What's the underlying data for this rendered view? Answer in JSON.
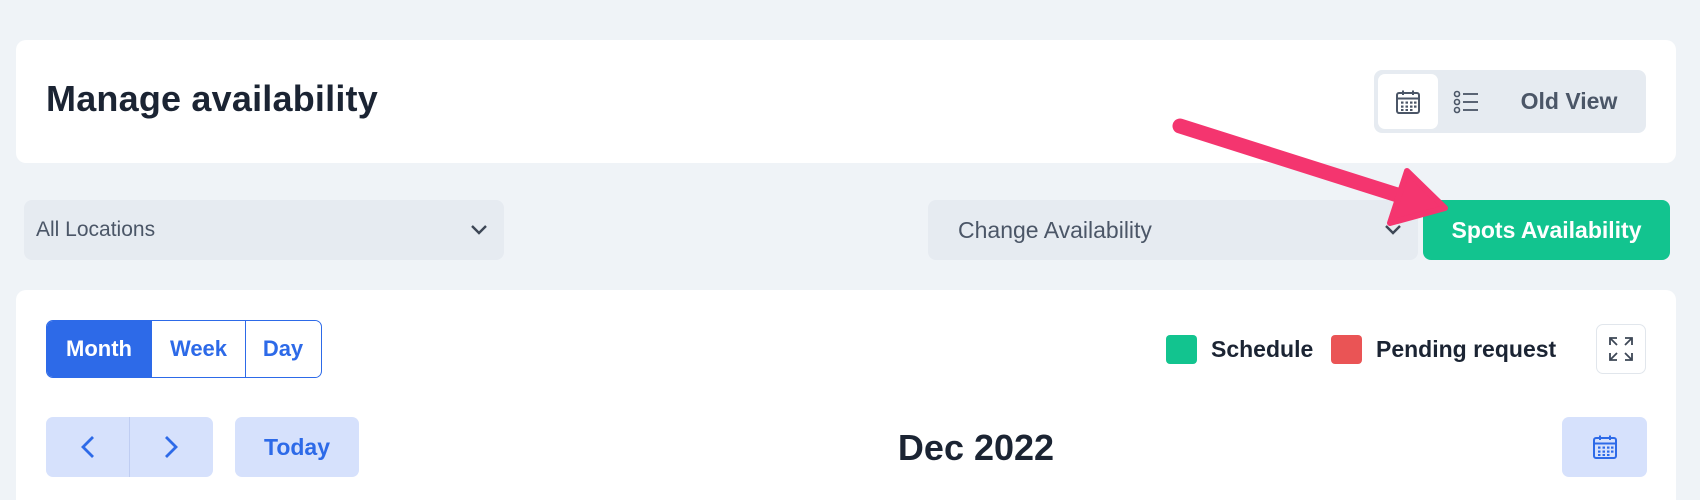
{
  "header": {
    "title": "Manage availability",
    "view_switch": {
      "calendar_icon": "calendar-icon",
      "list_icon": "list-icon",
      "old_view_label": "Old View"
    }
  },
  "filters": {
    "location": {
      "value": "All Locations",
      "icon": "chevron-down-icon"
    },
    "change_availability": {
      "value": "Change Availability",
      "icon": "chevron-down-icon"
    },
    "spots_availability_label": "Spots Availability"
  },
  "calendar": {
    "range_tabs": [
      {
        "label": "Month",
        "active": true
      },
      {
        "label": "Week",
        "active": false
      },
      {
        "label": "Day",
        "active": false
      }
    ],
    "legend": [
      {
        "label": "Schedule",
        "color": "#12c48f"
      },
      {
        "label": "Pending request",
        "color": "#ea5455"
      }
    ],
    "expand_icon": "expand-icon",
    "nav": {
      "prev_icon": "chevron-left-icon",
      "next_icon": "chevron-right-icon"
    },
    "today_label": "Today",
    "current_period": "Dec 2022",
    "date_picker_icon": "calendar-icon"
  },
  "colors": {
    "primary": "#2d6ae8",
    "success": "#12c48f",
    "danger": "#ea5455",
    "annotation": "#f4356f",
    "page_bg": "#eff3f7"
  }
}
